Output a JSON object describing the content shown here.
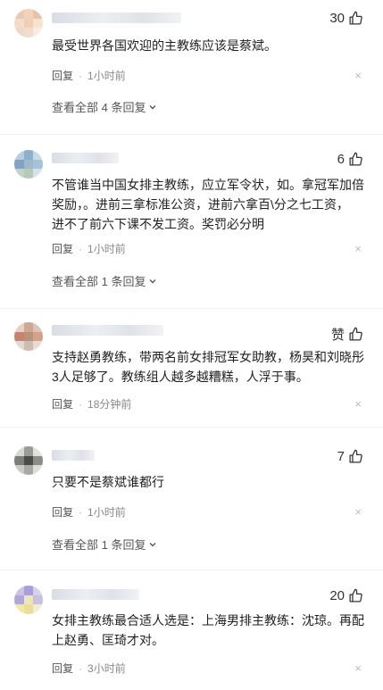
{
  "colors": {
    "text": "#1f1f1f",
    "meta": "#888888",
    "reply": "#555555"
  },
  "icons": {
    "like": "thumbs-up-icon",
    "close": "close-icon",
    "expand": "chevron-down-icon"
  },
  "comments": [
    {
      "likes": "30",
      "text": "最受世界各国欢迎的主教练应该是蔡斌。",
      "reply_label": "回复",
      "time": "1小时前",
      "close": "×",
      "view_all": "查看全部 4 条回复"
    },
    {
      "likes": "6",
      "text": "不管谁当中国女排主教练，应立军令状，如。拿冠军加倍\n奖励，。进前三拿标准公资，进前六拿百\\分之七工资，\n进不了前六下课不发工资。奖罚必分明",
      "reply_label": "回复",
      "time": "1小时前",
      "close": "×",
      "view_all": "查看全部 1 条回复"
    },
    {
      "likes": "赞",
      "text": "支持赵勇教练，带两名前女排冠军女助教，杨昊和刘晓彤\n3人足够了。教练组人越多越糟糕，人浮于事。",
      "reply_label": "回复",
      "time": "18分钟前",
      "close": "×"
    },
    {
      "likes": "7",
      "text": "只要不是蔡斌谁都行",
      "reply_label": "回复",
      "time": "1小时前",
      "close": "×",
      "view_all": "查看全部 1 条回复"
    },
    {
      "likes": "20",
      "text": "女排主教练最合适人选是：上海男排主教练：沈琼。再配\n上赵勇、匡琦才对。",
      "reply_label": "回复",
      "time": "3小时前",
      "close": "×"
    }
  ]
}
